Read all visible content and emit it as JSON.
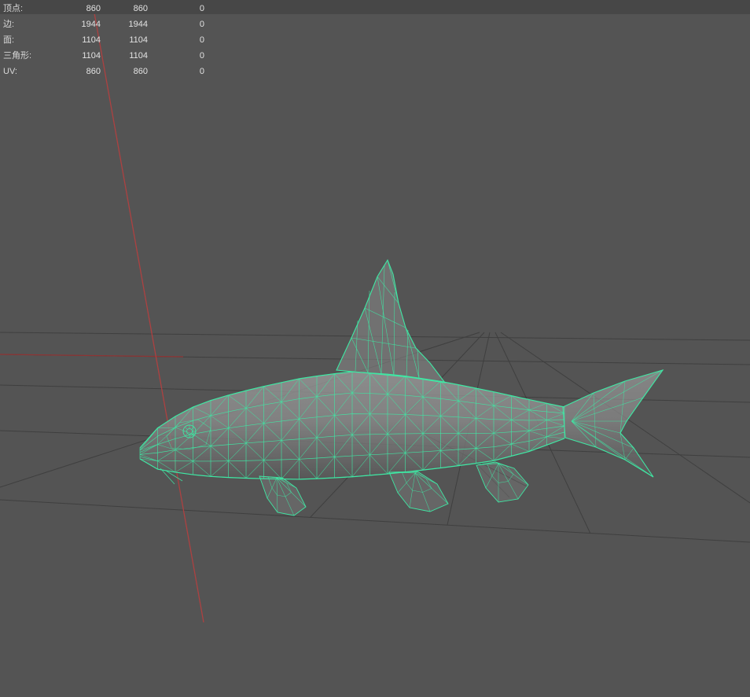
{
  "stats_panel": {
    "rows": [
      {
        "label": "顶点:",
        "values": [
          "860",
          "860",
          "0"
        ]
      },
      {
        "label": "边:",
        "values": [
          "1944",
          "1944",
          "0"
        ]
      },
      {
        "label": "面:",
        "values": [
          "1104",
          "1104",
          "0"
        ]
      },
      {
        "label": "三角形:",
        "values": [
          "1104",
          "1104",
          "0"
        ]
      },
      {
        "label": "UV:",
        "values": [
          "860",
          "860",
          "0"
        ]
      }
    ]
  },
  "viewport": {
    "background_color": "#545454",
    "top_strip_color": "#474747",
    "grid_color": "#3f3f3f",
    "axis_red": "#b24040",
    "axis_red_dim": "#8f3434",
    "dark_edge_color": "#2b2b2b",
    "wireframe_color": "#3fe8a4",
    "model_name": "fish-wireframe-model"
  }
}
